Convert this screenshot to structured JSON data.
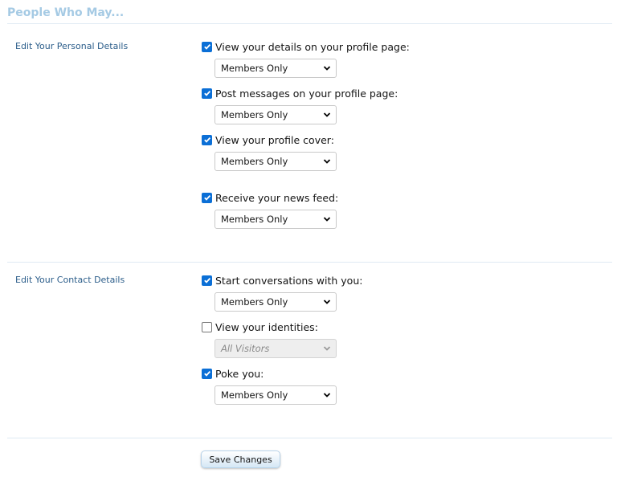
{
  "page": {
    "title": "People Who May..."
  },
  "sections": [
    {
      "label": "Edit Your Personal Details",
      "options": [
        {
          "label": "View your details on your profile page:",
          "checked": true,
          "value": "Members Only",
          "disabled": false
        },
        {
          "label": "Post messages on your profile page:",
          "checked": true,
          "value": "Members Only",
          "disabled": false
        },
        {
          "label": "View your profile cover:",
          "checked": true,
          "value": "Members Only",
          "disabled": false
        },
        {
          "label": "Receive your news feed:",
          "checked": true,
          "value": "Members Only",
          "disabled": false
        }
      ]
    },
    {
      "label": "Edit Your Contact Details",
      "options": [
        {
          "label": "Start conversations with you:",
          "checked": true,
          "value": "Members Only",
          "disabled": false
        },
        {
          "label": "View your identities:",
          "checked": false,
          "value": "All Visitors",
          "disabled": true
        },
        {
          "label": "Poke you:",
          "checked": true,
          "value": "Members Only",
          "disabled": false
        }
      ]
    }
  ],
  "actions": {
    "save_label": "Save Changes"
  },
  "colors": {
    "title": "#a5cae4",
    "section_label": "#2b5d8a",
    "checkbox": "#0b6fd6",
    "divider": "#dfeaf3"
  }
}
